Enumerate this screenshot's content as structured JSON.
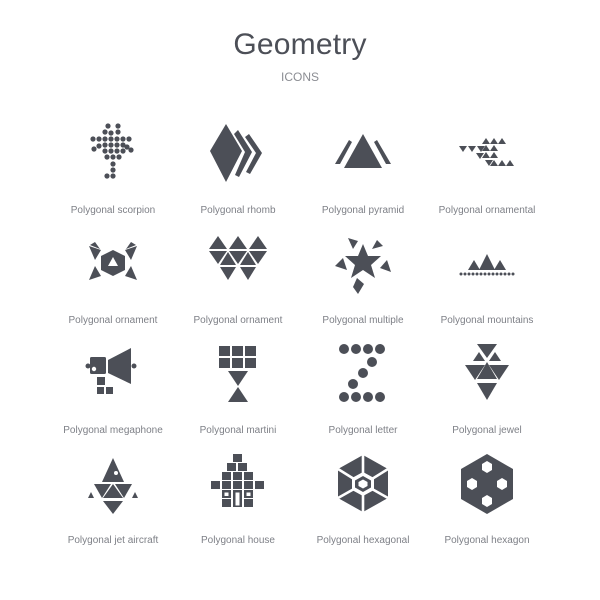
{
  "header": {
    "title": "Geometry",
    "subtitle": "ICONS"
  },
  "icon_color": "#4c4f57",
  "icons": [
    {
      "label": "Polygonal scorpion",
      "icon": "scorpion-icon"
    },
    {
      "label": "Polygonal rhomb",
      "icon": "rhomb-icon"
    },
    {
      "label": "Polygonal pyramid",
      "icon": "pyramid-icon"
    },
    {
      "label": "Polygonal ornamental",
      "icon": "ornamental-icon"
    },
    {
      "label": "Polygonal ornament",
      "icon": "ornament-hexagon-icon"
    },
    {
      "label": "Polygonal ornament",
      "icon": "ornament-triangles-icon"
    },
    {
      "label": "Polygonal multiple",
      "icon": "star-icon"
    },
    {
      "label": "Polygonal mountains",
      "icon": "mountains-icon"
    },
    {
      "label": "Polygonal megaphone",
      "icon": "megaphone-icon"
    },
    {
      "label": "Polygonal martini",
      "icon": "martini-icon"
    },
    {
      "label": "Polygonal letter",
      "icon": "letter-z-icon"
    },
    {
      "label": "Polygonal jewel",
      "icon": "jewel-icon"
    },
    {
      "label": "Polygonal jet aircraft",
      "icon": "jet-aircraft-icon"
    },
    {
      "label": "Polygonal house",
      "icon": "house-icon"
    },
    {
      "label": "Polygonal hexagonal",
      "icon": "hexagonal-icon"
    },
    {
      "label": "Polygonal hexagon",
      "icon": "hexagon-icon"
    }
  ]
}
